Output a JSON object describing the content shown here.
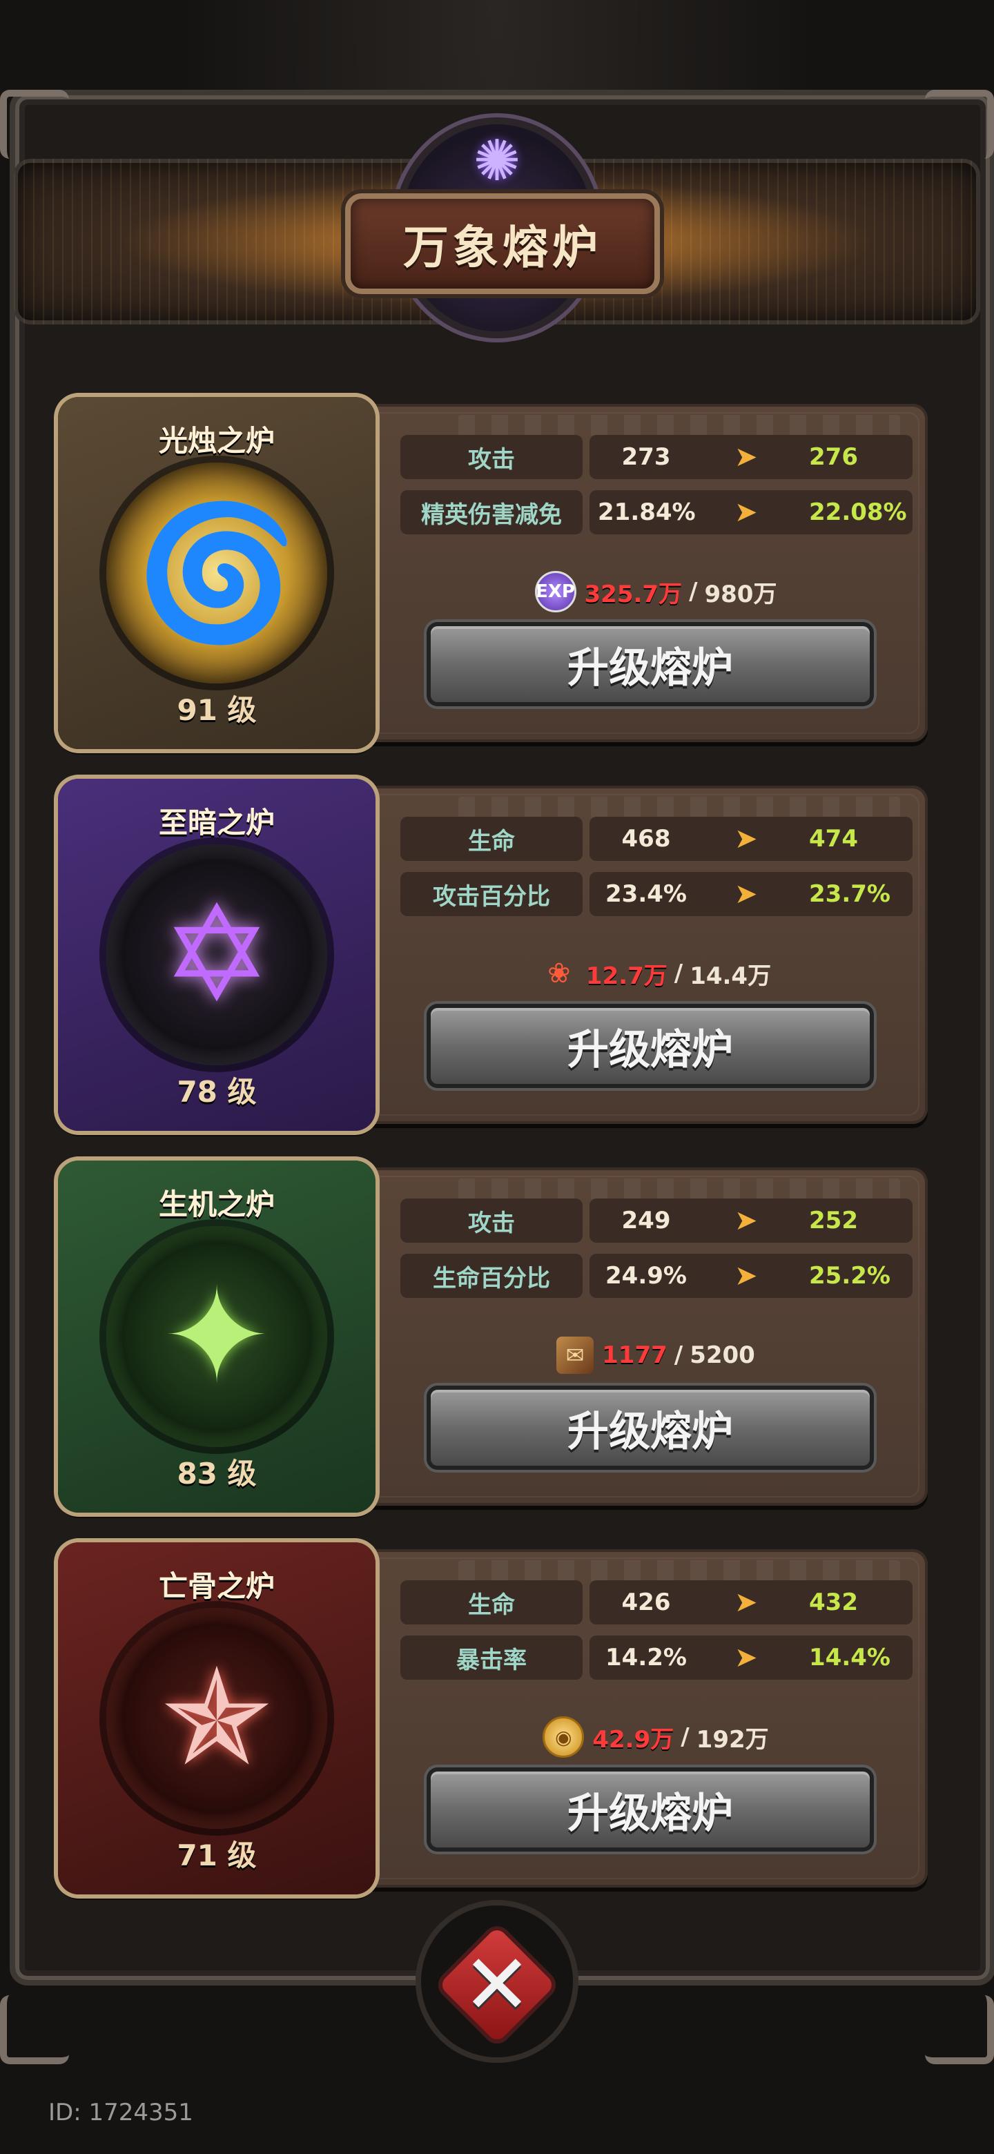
{
  "header": {
    "title": "万象熔炉"
  },
  "furnaces": [
    {
      "name": "光烛之炉",
      "level": "91 级",
      "stats": [
        {
          "label": "攻击",
          "current": "273",
          "next": "276"
        },
        {
          "label": "精英伤害减免",
          "current": "21.84%",
          "next": "22.08%"
        }
      ],
      "cost": {
        "icon": "exp-icon",
        "current": "325.7万",
        "separator": "/",
        "max": "980万"
      },
      "button": "升级熔炉"
    },
    {
      "name": "至暗之炉",
      "level": "78 级",
      "stats": [
        {
          "label": "生命",
          "current": "468",
          "next": "474"
        },
        {
          "label": "攻击百分比",
          "current": "23.4%",
          "next": "23.7%"
        }
      ],
      "cost": {
        "icon": "crystal-flower-icon",
        "current": "12.7万",
        "separator": "/",
        "max": "14.4万"
      },
      "button": "升级熔炉"
    },
    {
      "name": "生机之炉",
      "level": "83 级",
      "stats": [
        {
          "label": "攻击",
          "current": "249",
          "next": "252"
        },
        {
          "label": "生命百分比",
          "current": "24.9%",
          "next": "25.2%"
        }
      ],
      "cost": {
        "icon": "scroll-icon",
        "current": "1177",
        "separator": "/",
        "max": "5200"
      },
      "button": "升级熔炉"
    },
    {
      "name": "亡骨之炉",
      "level": "71 级",
      "stats": [
        {
          "label": "生命",
          "current": "426",
          "next": "432"
        },
        {
          "label": "暴击率",
          "current": "14.2%",
          "next": "14.4%"
        }
      ],
      "cost": {
        "icon": "gold-coin-icon",
        "current": "42.9万",
        "separator": "/",
        "max": "192万"
      },
      "button": "升级熔炉"
    }
  ],
  "arrow": "➤",
  "footer": {
    "id_text": "ID: 1724351"
  },
  "colors": {
    "accent_red": "#ff3a3a",
    "next_value_green": "#c7e84a",
    "stat_label_teal": "#9fd6c8",
    "arrow_orange": "#f3b03a"
  }
}
